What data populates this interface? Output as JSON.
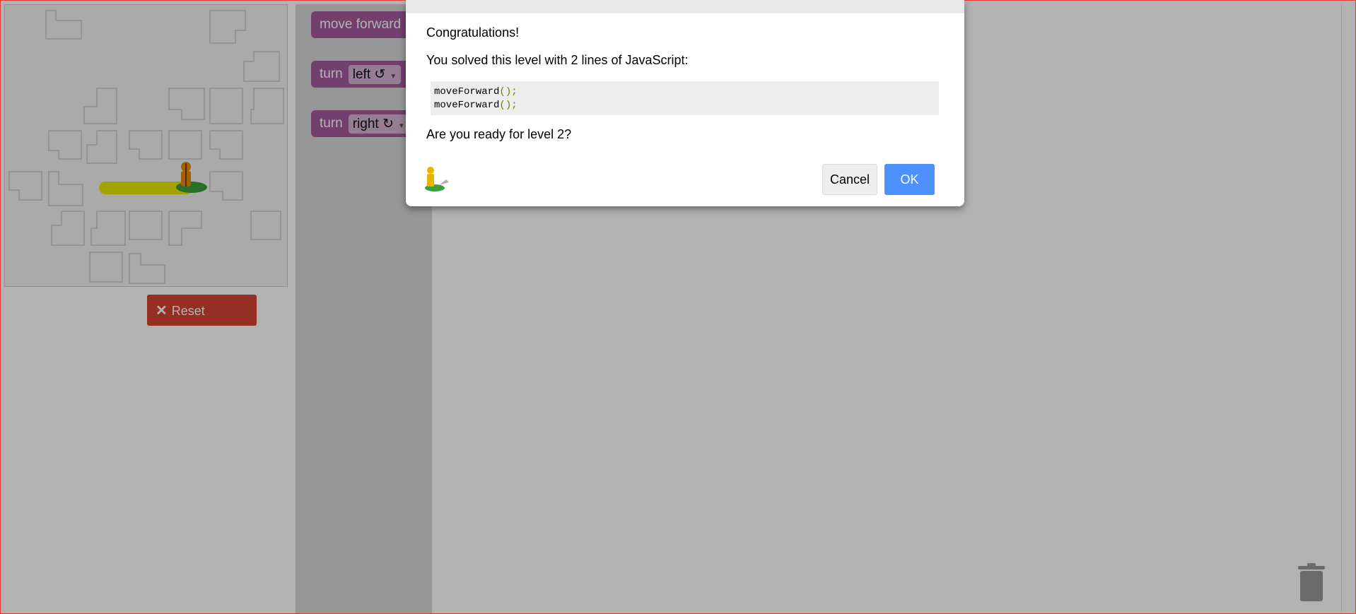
{
  "toolbox": {
    "move_forward_label": "move forward",
    "turn_left": {
      "label": "turn",
      "value": "left ↺"
    },
    "turn_right": {
      "label": "turn",
      "value": "right ↻"
    }
  },
  "reset": {
    "icon": "close-icon",
    "label": "Reset"
  },
  "dialog": {
    "title": "Congratulations!",
    "message": "You solved this level with 2 lines of JavaScript:",
    "code_lines": [
      {
        "name": "moveForward",
        "args": "();"
      },
      {
        "name": "moveForward",
        "args": "();"
      }
    ],
    "question": "Are you ready for level 2?",
    "cancel_label": "Cancel",
    "ok_label": "OK"
  },
  "icons": {
    "trash": "trash-icon",
    "pegman": "pegman-icon"
  },
  "colors": {
    "reset": "#d64333",
    "block": "#a55b9f",
    "ok": "#4d90fe",
    "path": "#e8e800"
  }
}
